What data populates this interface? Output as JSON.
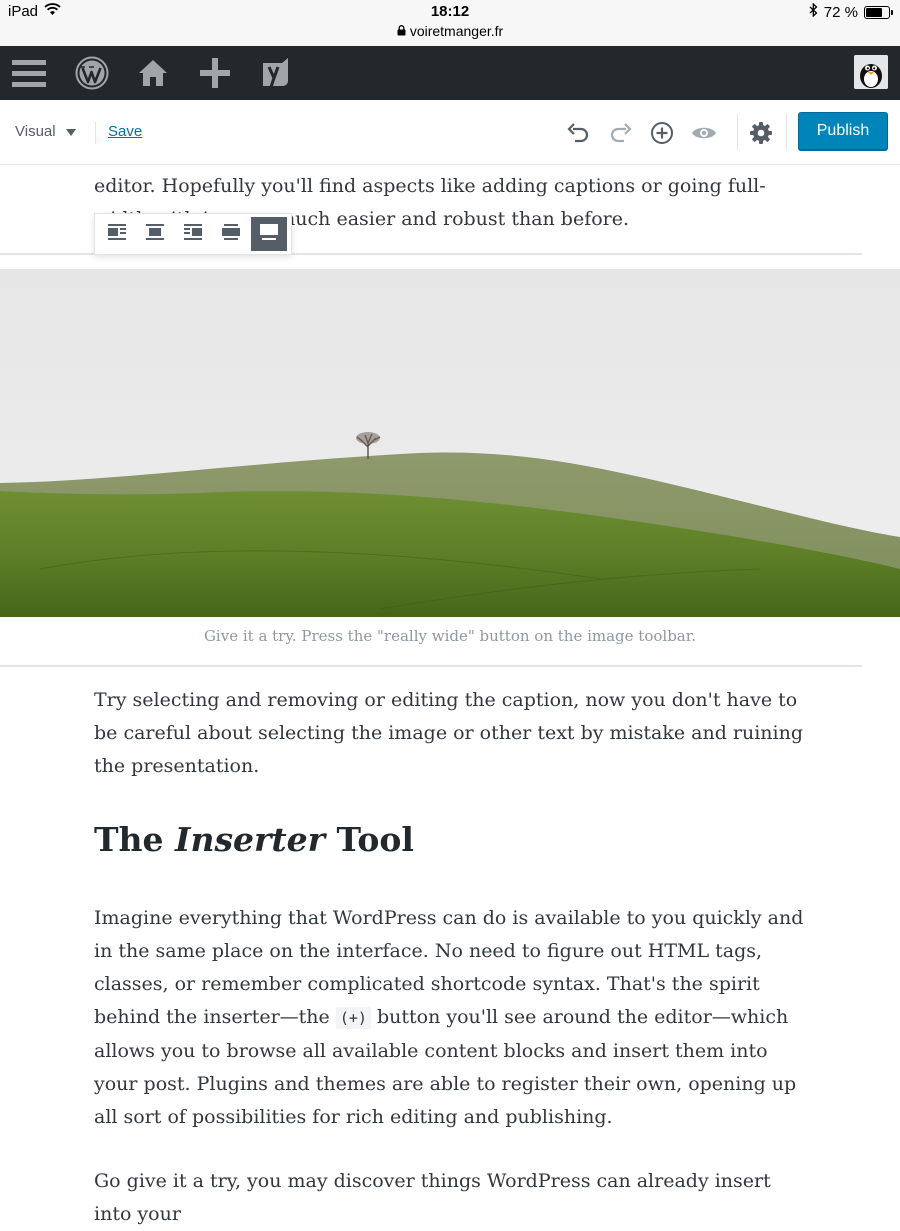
{
  "status_bar": {
    "device": "iPad",
    "time": "18:12",
    "url": "voiretmanger.fr",
    "battery_text": "72 %",
    "battery_level": 0.72
  },
  "admin_bar": {
    "icons": [
      "menu-icon",
      "wordpress-logo-icon",
      "home-icon",
      "plus-icon",
      "yoast-icon"
    ],
    "avatar": "user-avatar"
  },
  "editor_toolbar": {
    "mode_label": "Visual",
    "save_label": "Save",
    "publish_label": "Publish",
    "icons": [
      "undo-icon",
      "redo-icon",
      "insert-icon",
      "preview-eye-icon",
      "settings-gear-icon"
    ]
  },
  "content": {
    "intro_paragraph": "editor. Hopefully you'll find aspects like adding captions or going full-width with images much easier and robust than before.",
    "image_toolbar_icons": [
      "align-left-icon",
      "align-center-icon",
      "align-right-icon",
      "align-wide-icon",
      "align-full-icon"
    ],
    "image_toolbar_active": 4,
    "caption": "Give it a try. Press the \"really wide\" button on the image toolbar.",
    "paragraph_2": "Try selecting and removing or editing the caption, now you don't have to be careful about selecting the image or other text by mistake and ruining the presentation.",
    "heading_pre": "The ",
    "heading_em": "Inserter",
    "heading_post": " Tool",
    "paragraph_3_part1": "Imagine everything that WordPress can do is available to you quickly and in the same place on the interface. No need to figure out HTML tags, classes, or remember complicated shortcode syntax. That's the spirit behind the inserter—the ",
    "paragraph_3_code": "(+)",
    "paragraph_3_part2": " button you'll see around the editor—which allows you to browse all available content blocks and insert them into your post. Plugins and themes are able to register their own, opening up all sort of possibilities for rich editing and publishing.",
    "paragraph_4": "Go give it a try, you may discover things WordPress can already insert into your"
  },
  "colors": {
    "admin_bar": "#23282d",
    "publish": "#0085ba",
    "link": "#0073aa"
  }
}
